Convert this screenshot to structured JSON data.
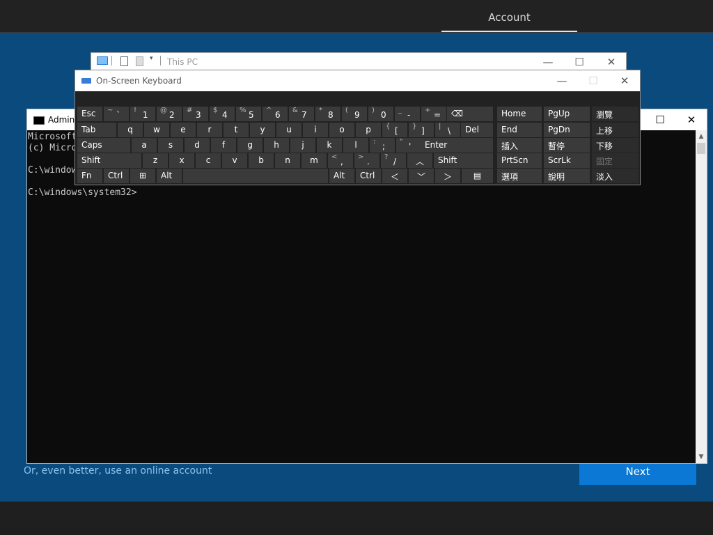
{
  "setup": {
    "tab": "Account",
    "online_link": "Or, even better, use an online account",
    "next": "Next"
  },
  "explorer": {
    "title": "This PC"
  },
  "cmd": {
    "title": "Admini",
    "lines": [
      "Microsoft",
      "(c) Micro",
      "",
      "C:\\window",
      "",
      "C:\\windows\\system32>"
    ]
  },
  "osk": {
    "title": "On-Screen Keyboard",
    "keys": {
      "esc": "Esc",
      "tab": "Tab",
      "caps": "Caps",
      "shift": "Shift",
      "shift_r": "Shift",
      "fn": "Fn",
      "ctrl": "Ctrl",
      "alt": "Alt",
      "alt_r": "Alt",
      "ctrl_r": "Ctrl",
      "del": "Del",
      "enter": "Enter",
      "home": "Home",
      "pgup": "PgUp",
      "end": "End",
      "pgdn": "PgDn",
      "ins": "插入",
      "pause": "暫停",
      "prtscn": "PrtScn",
      "scrlk": "ScrLk",
      "options": "選項",
      "help": "說明",
      "nav": "瀏覽",
      "moveup": "上移",
      "movedown": "下移",
      "dock": "固定",
      "fade": "淡入"
    },
    "row1": [
      {
        "s": "~",
        "m": "`"
      },
      {
        "s": "!",
        "m": "1"
      },
      {
        "s": "@",
        "m": "2"
      },
      {
        "s": "#",
        "m": "3"
      },
      {
        "s": "$",
        "m": "4"
      },
      {
        "s": "%",
        "m": "5"
      },
      {
        "s": "^",
        "m": "6"
      },
      {
        "s": "&",
        "m": "7"
      },
      {
        "s": "*",
        "m": "8"
      },
      {
        "s": "(",
        "m": "9"
      },
      {
        "s": ")",
        "m": "0"
      },
      {
        "s": "_",
        "m": "-"
      },
      {
        "s": "+",
        "m": "="
      }
    ],
    "row2": [
      "q",
      "w",
      "e",
      "r",
      "t",
      "y",
      "u",
      "i",
      "o",
      "p"
    ],
    "row2_sym": [
      {
        "s": "{",
        "m": "["
      },
      {
        "s": "}",
        "m": "]"
      },
      {
        "s": "|",
        "m": "\\"
      }
    ],
    "row3": [
      "a",
      "s",
      "d",
      "f",
      "g",
      "h",
      "j",
      "k",
      "l"
    ],
    "row3_sym": [
      {
        "s": ":",
        "m": ";"
      },
      {
        "s": "\"",
        "m": "'"
      }
    ],
    "row4": [
      "z",
      "x",
      "c",
      "v",
      "b",
      "n",
      "m"
    ],
    "row4_sym": [
      {
        "s": "<",
        "m": ","
      },
      {
        "s": ">",
        "m": "."
      },
      {
        "s": "?",
        "m": "/"
      }
    ]
  }
}
